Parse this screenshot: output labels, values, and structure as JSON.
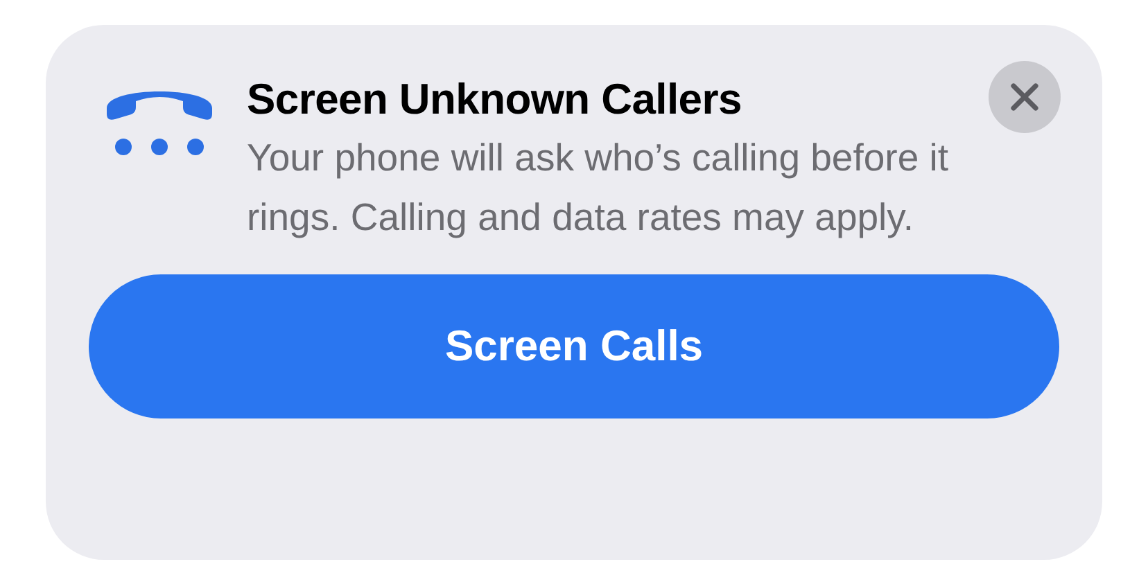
{
  "banner": {
    "title": "Screen Unknown Callers",
    "message": "Your phone will ask who’s calling before it rings. Calling and data rates may apply.",
    "primary_button": "Screen Calls"
  }
}
